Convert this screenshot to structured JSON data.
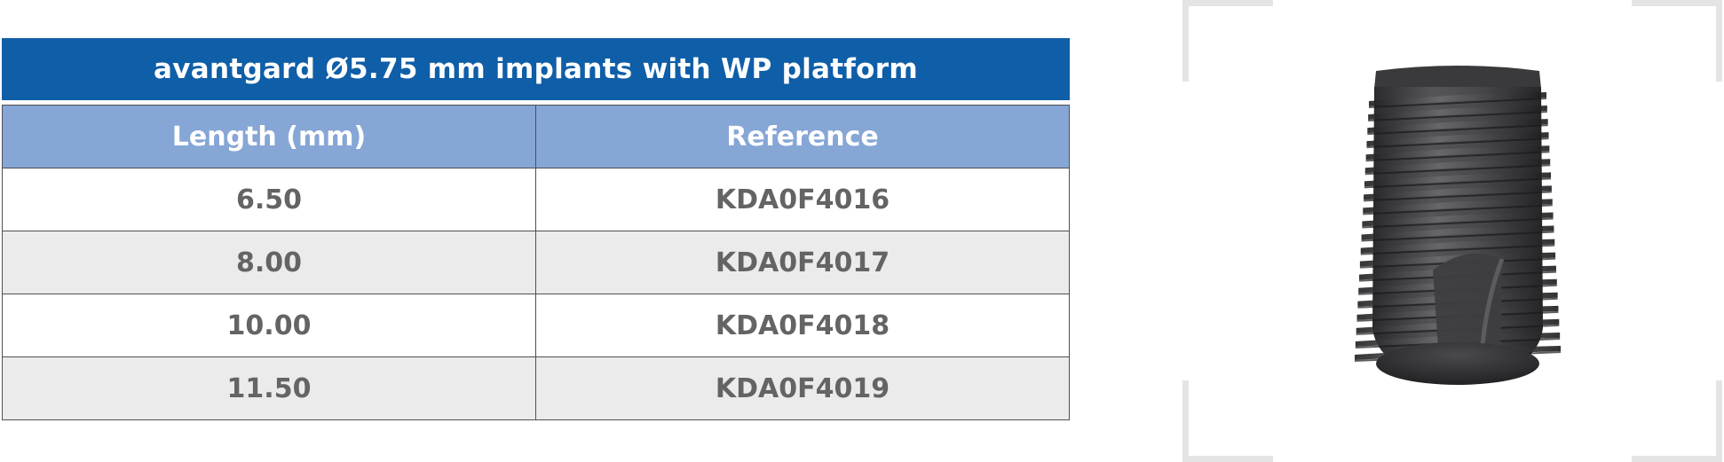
{
  "table": {
    "title": "avantgard Ø5.75 mm implants with WP platform",
    "columns": [
      "Length (mm)",
      "Reference"
    ],
    "rows": [
      {
        "length": "6.50",
        "reference": "KDA0F4016"
      },
      {
        "length": "8.00",
        "reference": "KDA0F4017"
      },
      {
        "length": "10.00",
        "reference": "KDA0F4018"
      },
      {
        "length": "11.50",
        "reference": "KDA0F4019"
      }
    ]
  },
  "colors": {
    "title_bar": "#0f5ea8",
    "header_row": "#86a6d6",
    "alt_row": "#ebebeb",
    "cell_text": "#646464",
    "implant_body": "#3c3c3e"
  },
  "product_image": {
    "icon": "dental-implant-icon"
  }
}
